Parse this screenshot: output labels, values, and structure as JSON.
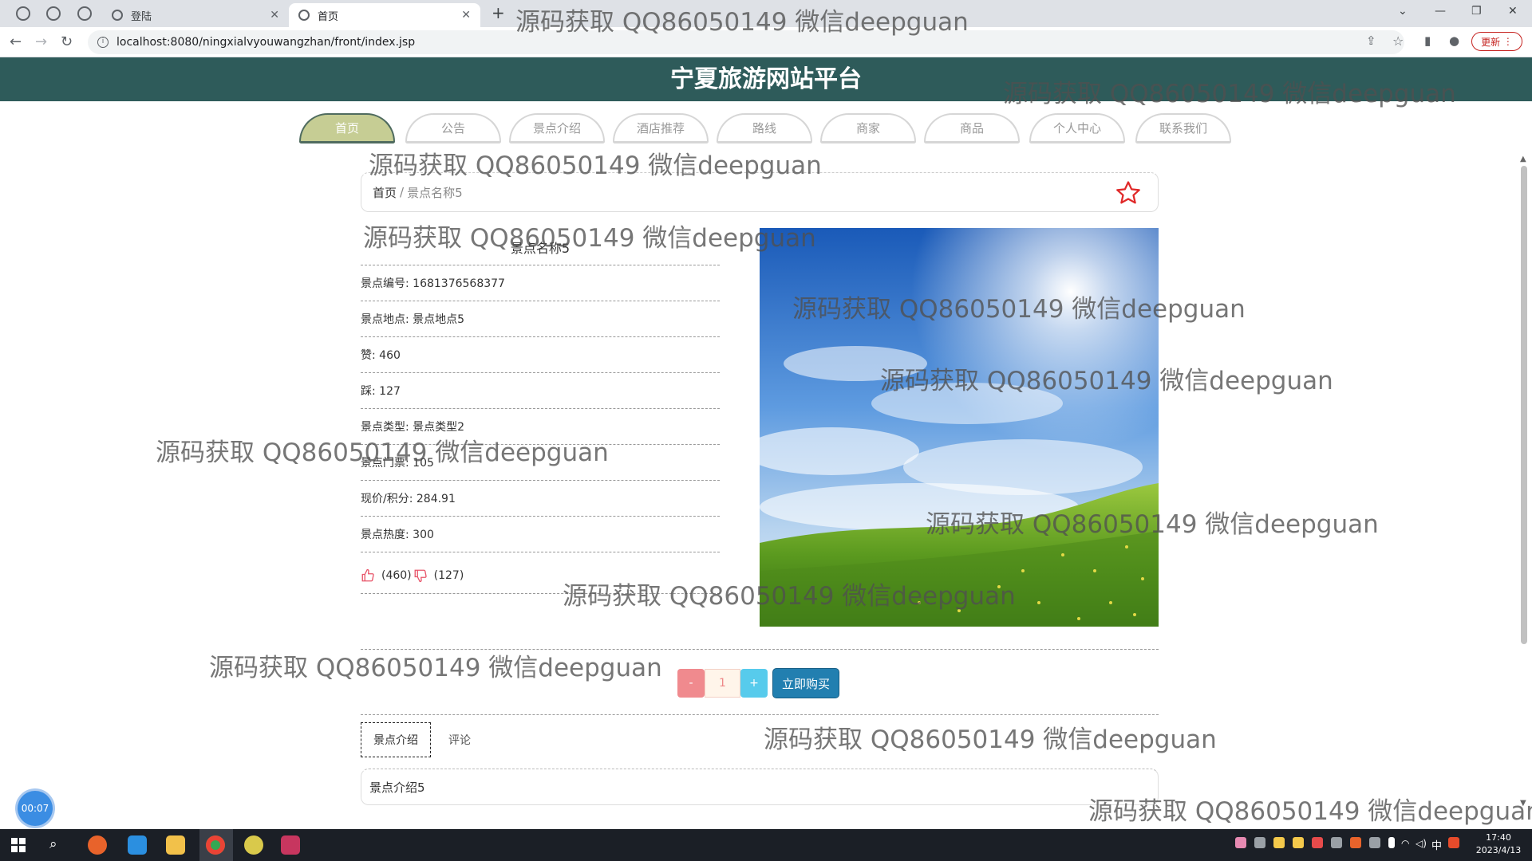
{
  "browser": {
    "tabs": [
      {
        "title": "登陆",
        "active": false
      },
      {
        "title": "首页",
        "active": true
      }
    ],
    "url": "localhost:8080/ningxialvyouwangzhan/front/index.jsp",
    "update_label": "更新"
  },
  "site": {
    "title": "宁夏旅游网站平台",
    "nav": [
      "首页",
      "公告",
      "景点介绍",
      "酒店推荐",
      "路线",
      "商家",
      "商品",
      "个人中心",
      "联系我们"
    ],
    "active_nav_index": 0
  },
  "breadcrumb": {
    "home": "首页",
    "separator": "/",
    "current": "景点名称5"
  },
  "detail": {
    "title": "景点名称5",
    "rows": [
      "景点编号: 1681376568377",
      "景点地点: 景点地点5",
      "赞: 460",
      "踩: 127",
      "景点类型: 景点类型2",
      "景点门票: 105",
      "现价/积分: 284.91",
      "景点热度: 300"
    ],
    "likes": "(460)",
    "dislikes": "(127)"
  },
  "purchase": {
    "minus": "-",
    "quantity": "1",
    "plus": "+",
    "buy_label": "立即购买"
  },
  "tabs": [
    {
      "label": "景点介绍",
      "active": true
    },
    {
      "label": "评论",
      "active": false
    }
  ],
  "intro_text": "景点介绍5",
  "recorder_time": "00:07",
  "watermark": "源码获取 QQ86050149 微信deepguan",
  "clock": {
    "time": "17:40",
    "date": "2023/4/13"
  },
  "colors": {
    "header_bg": "#2e5b5a",
    "nav_active": "#c6cd94",
    "buy_button": "#227fb0",
    "minus_button": "#f08a8e",
    "plus_button": "#57cbec"
  }
}
